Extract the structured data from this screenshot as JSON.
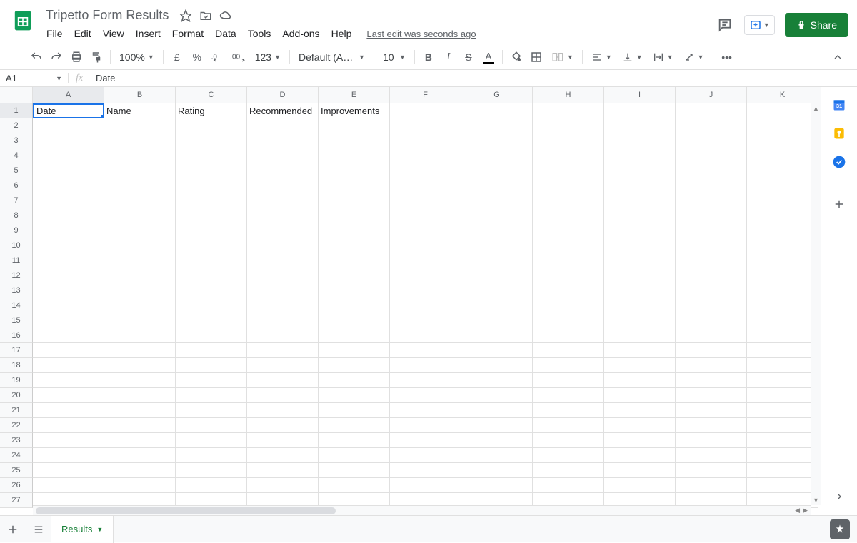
{
  "doc_title": "Tripetto Form Results",
  "menus": [
    "File",
    "Edit",
    "View",
    "Insert",
    "Format",
    "Data",
    "Tools",
    "Add-ons",
    "Help"
  ],
  "last_edit": "Last edit was seconds ago",
  "share_label": "Share",
  "toolbar": {
    "zoom": "100%",
    "currency": "£",
    "percent": "%",
    "dec_dec": ".0",
    "dec_inc": ".00",
    "more_formats": "123",
    "font": "Default (Ari...",
    "font_size": "10"
  },
  "name_box": "A1",
  "formula_value": "Date",
  "columns": [
    "A",
    "B",
    "C",
    "D",
    "E",
    "F",
    "G",
    "H",
    "I",
    "J",
    "K"
  ],
  "row_count": 27,
  "cells": {
    "r1": [
      "Date",
      "Name",
      "Rating",
      "Recommended",
      "Improvements",
      "",
      "",
      "",
      "",
      "",
      ""
    ]
  },
  "active_cell": {
    "row": 1,
    "col": 0
  },
  "tab_name": "Results"
}
